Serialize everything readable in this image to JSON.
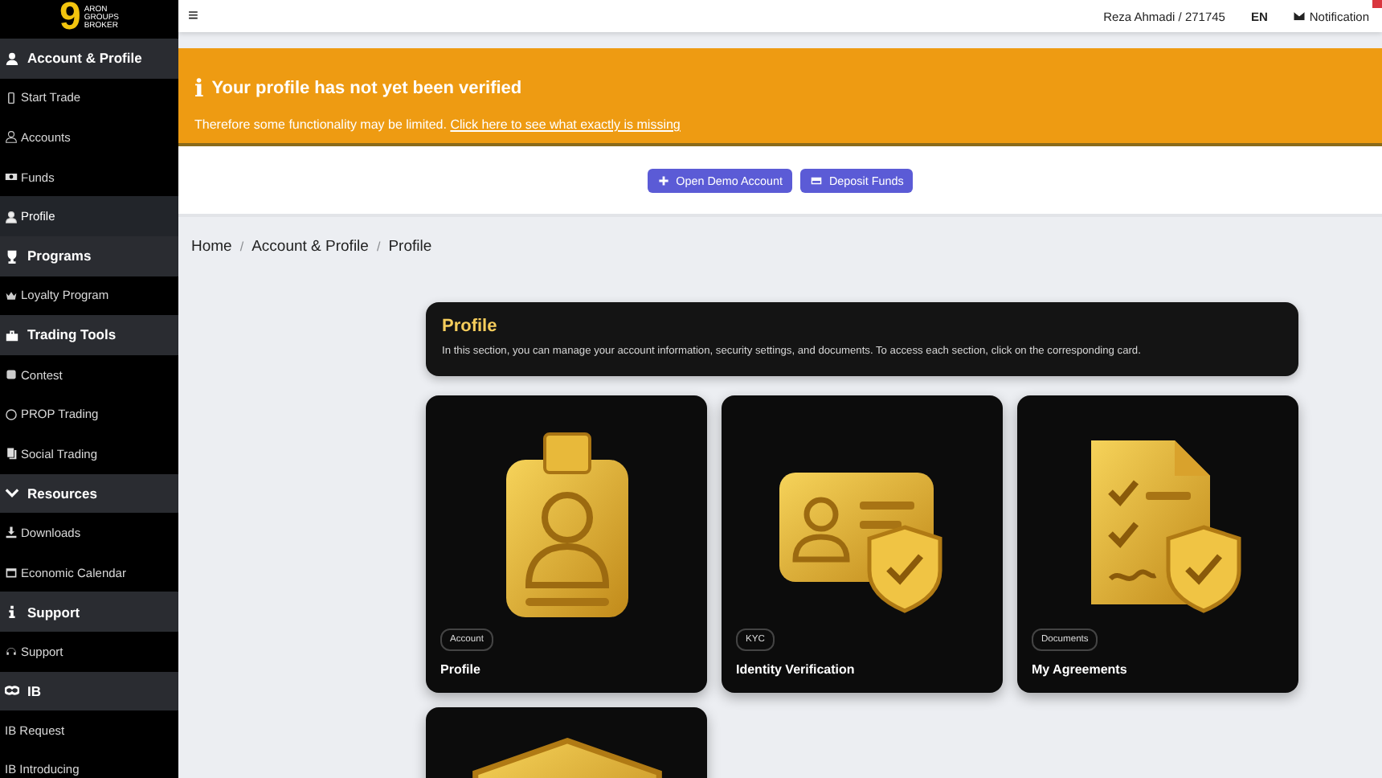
{
  "logo": {
    "mark": "9",
    "lines": [
      "ARON",
      "GROUPS",
      "BROKER"
    ]
  },
  "sidebar": {
    "sections": [
      {
        "title": "Account & Profile",
        "items": [
          {
            "label": "Start Trade",
            "selected": false
          },
          {
            "label": "Accounts",
            "selected": false
          },
          {
            "label": "Funds",
            "selected": false
          },
          {
            "label": "Profile",
            "selected": true
          }
        ]
      },
      {
        "title": "Programs",
        "items": [
          {
            "label": "Loyalty Program",
            "selected": false
          }
        ]
      },
      {
        "title": "Trading Tools",
        "items": [
          {
            "label": "Contest",
            "selected": false
          },
          {
            "label": "PROP Trading",
            "selected": false
          },
          {
            "label": "Social Trading",
            "selected": false
          }
        ]
      },
      {
        "title": "Resources",
        "items": [
          {
            "label": "Downloads",
            "selected": false
          },
          {
            "label": "Economic Calendar",
            "selected": false
          }
        ]
      },
      {
        "title": "Support",
        "items": [
          {
            "label": "Support",
            "selected": false
          }
        ]
      },
      {
        "title": "IB",
        "items": [
          {
            "label": "IB Request",
            "selected": false
          },
          {
            "label": "IB Introducing",
            "selected": false
          }
        ]
      }
    ]
  },
  "topbar": {
    "menu": "≡",
    "user": "Reza Ahmadi / 271745",
    "language": "EN",
    "notification": "Notification"
  },
  "alert": {
    "icon": "i",
    "title": "Your profile has not yet been verified",
    "text": "Therefore some functionality may be limited.",
    "link": "Click here to see what exactly is missing"
  },
  "actions": [
    {
      "label": "Open Demo Account"
    },
    {
      "label": "Deposit Funds"
    }
  ],
  "breadcrumb": {
    "separator": "/",
    "items": [
      "Home",
      "Account & Profile",
      "Profile"
    ]
  },
  "intro": {
    "title": "Profile",
    "text": "In this section, you can manage your account information, security settings, and documents. To access each section, click on the corresponding card."
  },
  "cards": [
    {
      "kind": "badge",
      "tag": "Account",
      "title": "Profile"
    },
    {
      "kind": "idcard",
      "tag": "KYC",
      "title": "Identity Verification"
    },
    {
      "kind": "document",
      "tag": "Documents",
      "title": "My Agreements"
    },
    {
      "kind": "shield"
    }
  ]
}
